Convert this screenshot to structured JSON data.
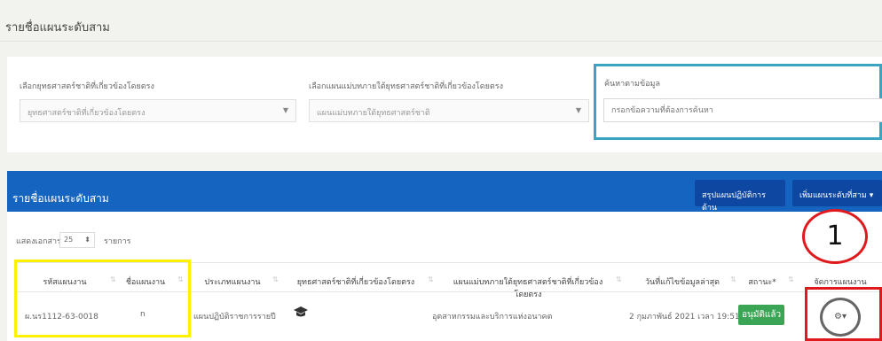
{
  "page_title": "รายชื่อแผนระดับสาม",
  "filters": {
    "strategy_label": "เลือกยุทธศาสตร์ชาติที่เกี่ยวข้องโดยตรง",
    "strategy_value": "ยุทธศาสตร์ชาติที่เกี่ยวข้องโดยตรง",
    "master_plan_label": "เลือกแผนแม่บทภายใต้ยุทธศาสตร์ชาติที่เกี่ยวข้องโดยตรง",
    "master_plan_value": "แผนแม่บทภายใต้ยุทธศาสตร์ชาติ",
    "search_label": "ค้นหาตามข้อมูล",
    "search_placeholder": "กรอกข้อความที่ต้องการค้นหา"
  },
  "table_panel": {
    "title": "รายชื่อแผนระดับสาม",
    "summary_button": "สรุปแผนปฏิบัติการด้าน",
    "add_button": "เพิ่มแผนระดับที่สาม",
    "show_label": "แสดงเอกสาร",
    "page_size": "25",
    "items_label": "รายการ"
  },
  "columns": [
    "รหัสแผนงาน",
    "ชื่อแผนงาน",
    "ประเภทแผนงาน",
    "ยุทธศาสตร์ชาติที่เกี่ยวข้องโดยตรง",
    "แผนแม่บทภายใต้ยุทธศาสตร์ชาติที่เกี่ยวข้องโดยตรง",
    "วันที่แก้ไขข้อมูลล่าสุด",
    "สถานะ*",
    "จัดการแผนงาน"
  ],
  "rows": [
    {
      "code": "ผ.นร1112-63-0018",
      "name": "n",
      "type": "แผนปฏิบัติราชการรายปี",
      "strategy_icon": "graduation-cap-icon",
      "master_plan": "อุตสาหกรรมและบริการแห่งอนาคต",
      "updated": "2 กุมภาพันธ์ 2021 เวลา 19:51",
      "status": "อนุมัติแล้ว",
      "action_icon": "gear-icon"
    }
  ],
  "annotation_number": "1",
  "colors": {
    "header_blue": "#1565c0",
    "button_blue": "#0d47a1",
    "status_green": "#3aa655",
    "highlight_yellow": "#fff200",
    "highlight_red": "#e0191c",
    "search_border": "#3aa5c0"
  }
}
